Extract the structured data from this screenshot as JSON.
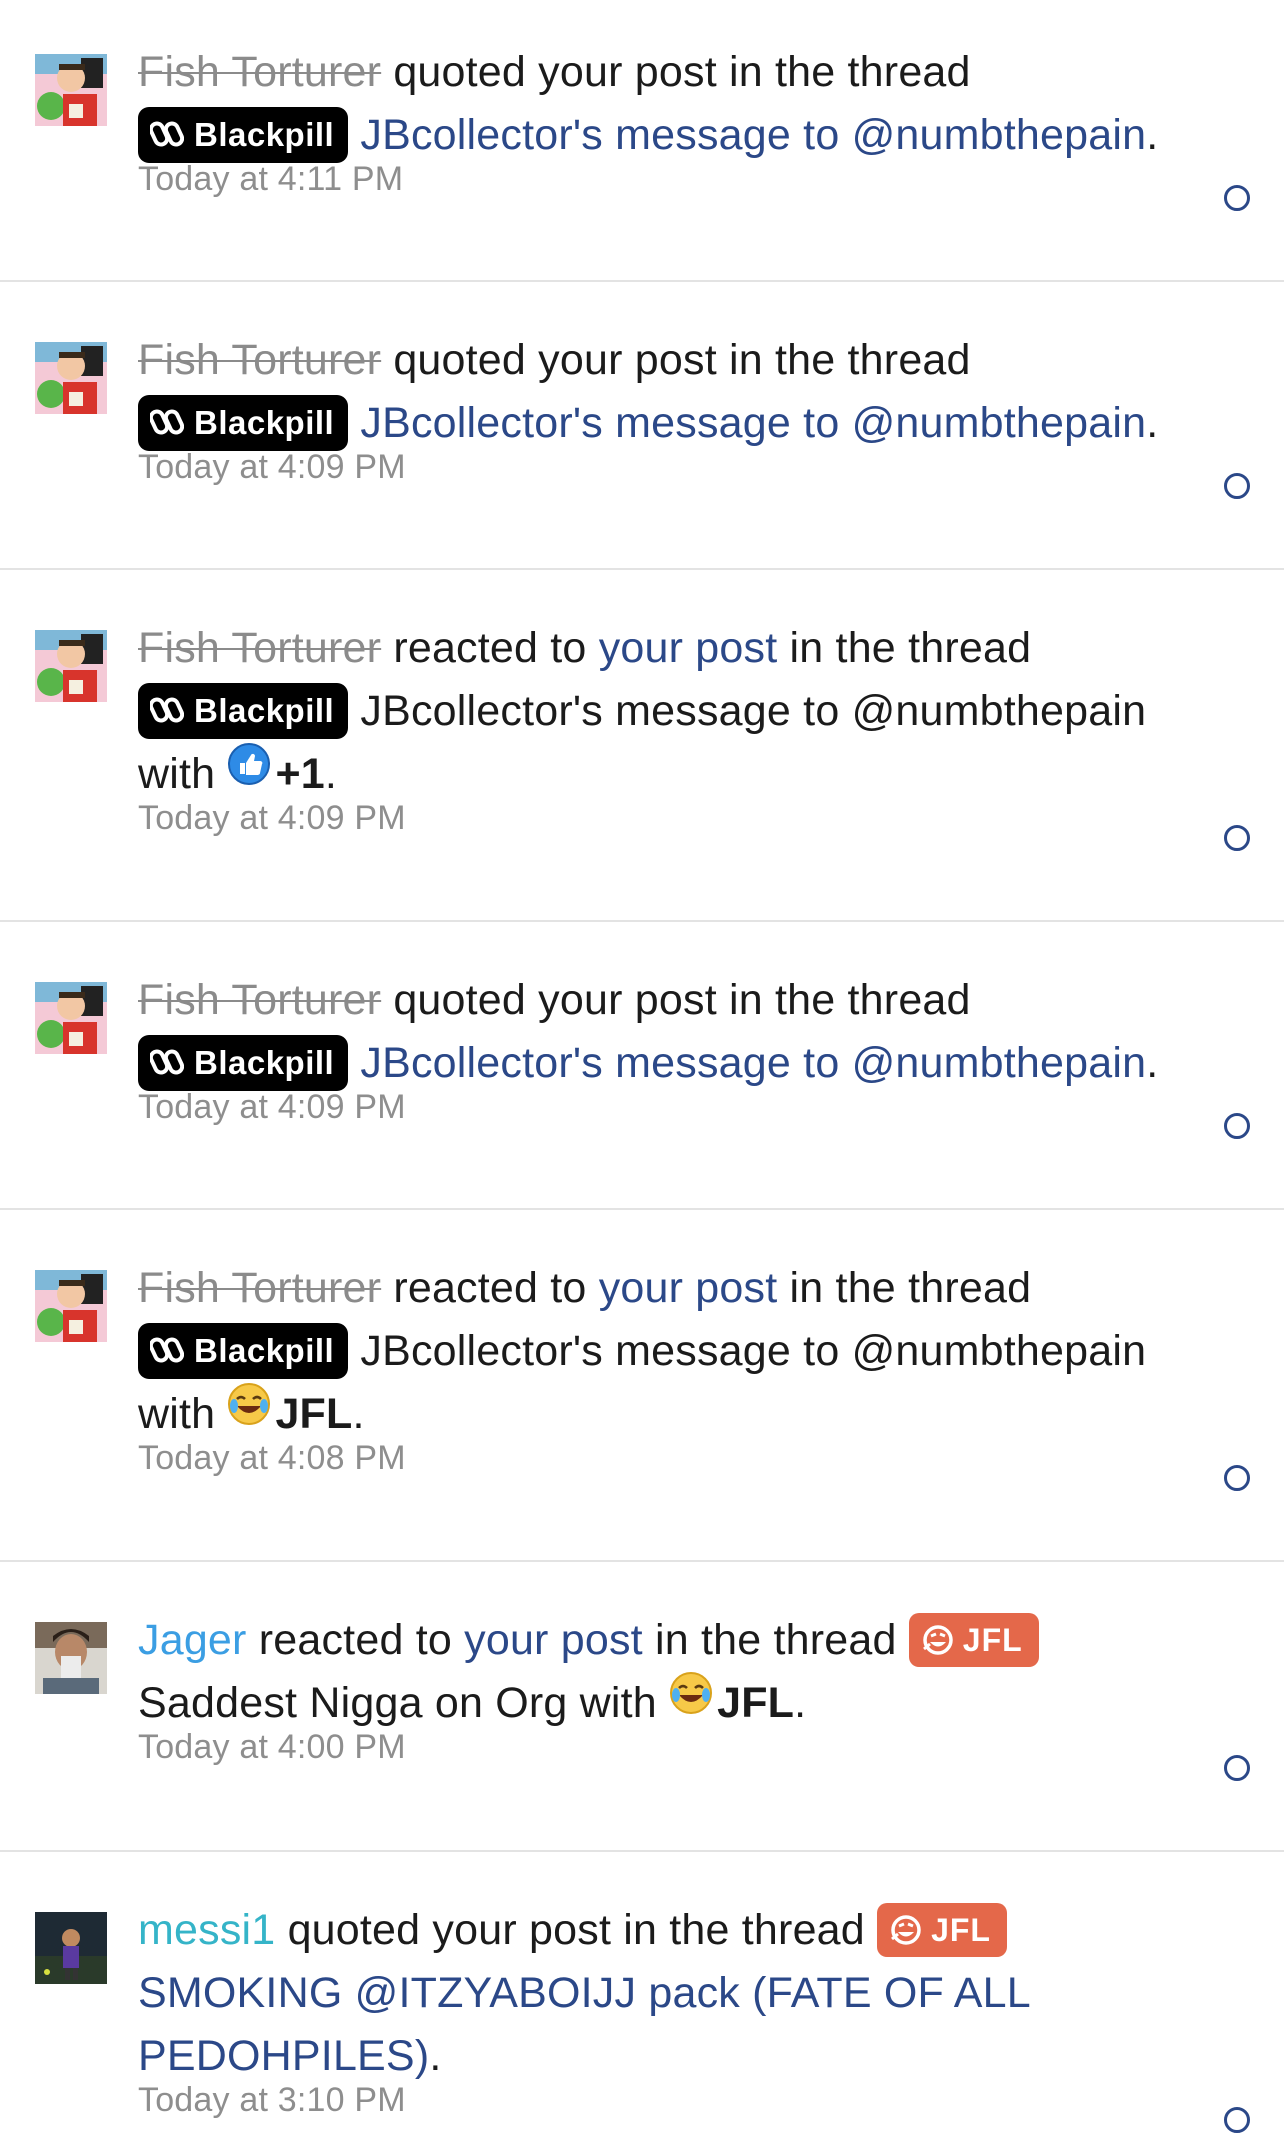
{
  "notifications": [
    {
      "user": "Fish Torturer",
      "action": "quoted your post in the thread",
      "prefix": "Blackpill",
      "thread": "JBcollector's message to @numbthepain",
      "time": "Today at 4:11 PM"
    },
    {
      "user": "Fish Torturer",
      "action": "quoted your post in the thread",
      "prefix": "Blackpill",
      "thread": "JBcollector's message to @numbthepain",
      "time": "Today at 4:09 PM"
    },
    {
      "user": "Fish Torturer",
      "action_pre": "reacted to",
      "action_link": "your post",
      "action_post": "in the thread",
      "prefix": "Blackpill",
      "thread": "JBcollector's message to @numbthepain",
      "with": "with",
      "reaction": "+1",
      "time": "Today at 4:09 PM"
    },
    {
      "user": "Fish Torturer",
      "action": "quoted your post in the thread",
      "prefix": "Blackpill",
      "thread": "JBcollector's message to @numbthepain",
      "time": "Today at 4:09 PM"
    },
    {
      "user": "Fish Torturer",
      "action_pre": "reacted to",
      "action_link": "your post",
      "action_post": "in the thread",
      "prefix": "Blackpill",
      "thread": "JBcollector's message to @numbthepain",
      "with": "with",
      "reaction": "JFL",
      "time": "Today at 4:08 PM"
    },
    {
      "user": "Jager",
      "action_pre": "reacted to",
      "action_link": "your post",
      "action_post": "in the thread",
      "prefix": "JFL",
      "thread": "Saddest Nigga on Org",
      "with": "with",
      "reaction": "JFL",
      "time": "Today at 4:00 PM"
    },
    {
      "user": "messi1",
      "action": "quoted your post in the thread",
      "prefix": "JFL",
      "thread_line1": "SMOKING @ITZYABOIJJ pack (FATE OF ALL",
      "thread_line2": "PEDOHPILES)",
      "time": "Today at 3:10 PM"
    }
  ],
  "colors": {
    "link": "#2b4888",
    "user_strike": "#8b8b8b",
    "user_blue": "#3b9ee3",
    "user_teal": "#35b4c8",
    "badge_black": "#000000",
    "badge_orange": "#e4684a",
    "time": "#8e8e8e"
  },
  "icons": {
    "blackpill_prefix": "pills-icon",
    "jfl_prefix": "laughing-face-icon",
    "reaction_like": "thumbs-up-icon",
    "reaction_jfl": "crying-laughing-emoji-icon",
    "unread": "unread-circle-icon"
  }
}
